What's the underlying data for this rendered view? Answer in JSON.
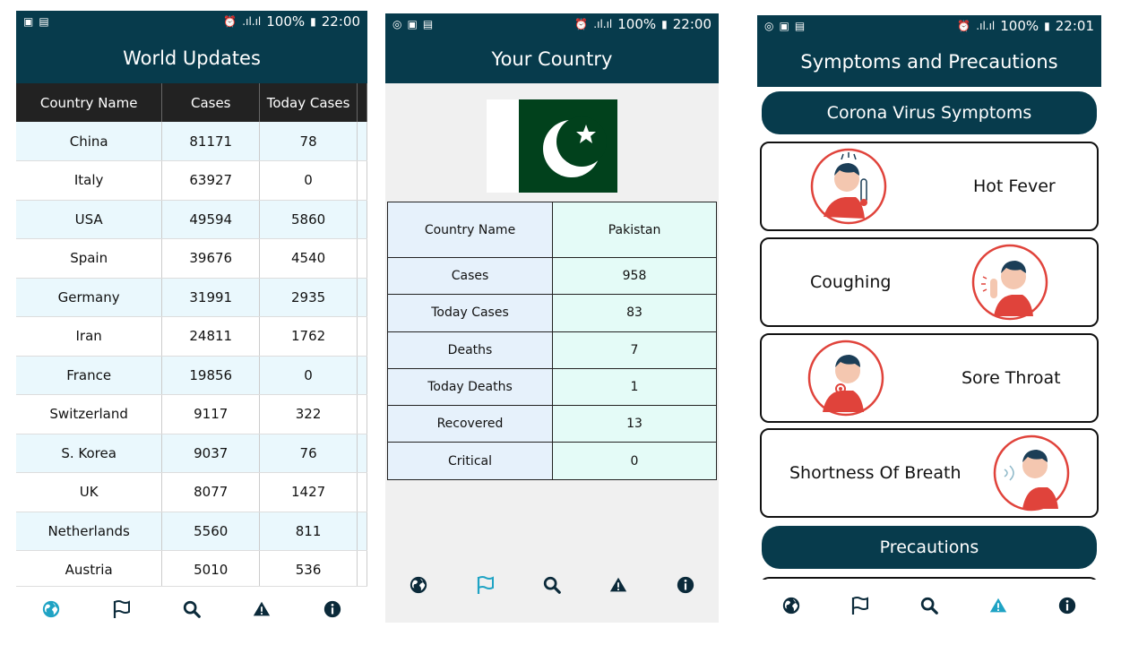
{
  "status1": {
    "time": "22:00",
    "battery": "100%"
  },
  "status2": {
    "time": "22:00",
    "battery": "100%"
  },
  "status3": {
    "time": "22:01",
    "battery": "100%"
  },
  "screen1": {
    "title": "World Updates",
    "headers": [
      "Country Name",
      "Cases",
      "Today Cases"
    ],
    "rows": [
      [
        "China",
        "81171",
        "78"
      ],
      [
        "Italy",
        "63927",
        "0"
      ],
      [
        "USA",
        "49594",
        "5860"
      ],
      [
        "Spain",
        "39676",
        "4540"
      ],
      [
        "Germany",
        "31991",
        "2935"
      ],
      [
        "Iran",
        "24811",
        "1762"
      ],
      [
        "France",
        "19856",
        "0"
      ],
      [
        "Switzerland",
        "9117",
        "322"
      ],
      [
        "S. Korea",
        "9037",
        "76"
      ],
      [
        "UK",
        "8077",
        "1427"
      ],
      [
        "Netherlands",
        "5560",
        "811"
      ],
      [
        "Austria",
        "5010",
        "536"
      ]
    ],
    "active_nav": "globe"
  },
  "screen2": {
    "title": "Your Country",
    "flag": "pakistan-flag",
    "rows": [
      [
        "Country Name",
        "Pakistan"
      ],
      [
        "Cases",
        "958"
      ],
      [
        "Today Cases",
        "83"
      ],
      [
        "Deaths",
        "7"
      ],
      [
        "Today Deaths",
        "1"
      ],
      [
        "Recovered",
        "13"
      ],
      [
        "Critical",
        "0"
      ]
    ],
    "active_nav": "flag"
  },
  "screen3": {
    "title": "Symptoms and Precautions",
    "symptoms_button": "Corona Virus Symptoms",
    "symptoms": [
      "Hot Fever",
      "Coughing",
      "Sore Throat",
      "Shortness Of Breath"
    ],
    "precautions_button": "Precautions",
    "active_nav": "warning"
  },
  "nav_icons": [
    "globe-icon",
    "flag-icon",
    "search-icon",
    "warning-icon",
    "info-icon"
  ],
  "colors": {
    "primary": "#073b4c",
    "active": "#1fa3c4",
    "accent_red": "#e0433b"
  }
}
